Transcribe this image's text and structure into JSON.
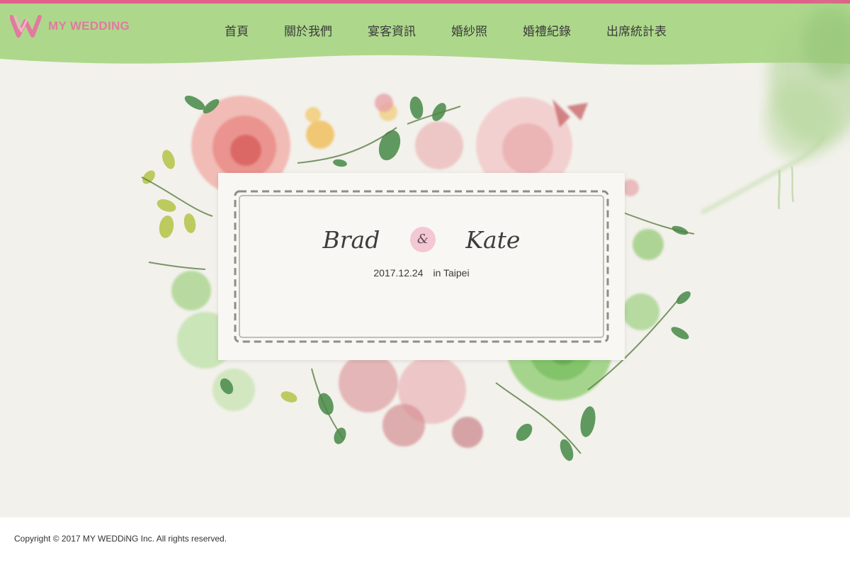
{
  "brand": {
    "name": "MY WEDDING",
    "color": "#e27aa0"
  },
  "accent": {
    "topline": "#e0608a",
    "nav_green": "#add88b"
  },
  "nav": {
    "items": [
      {
        "label": "首頁"
      },
      {
        "label": "關於我們"
      },
      {
        "label": "宴客資訊"
      },
      {
        "label": "婚紗照"
      },
      {
        "label": "婚禮紀錄"
      },
      {
        "label": "出席統計表"
      }
    ]
  },
  "hero": {
    "groom": "Brad",
    "ampersand": "&",
    "bride": "Kate",
    "date": "2017.12.24",
    "location": "in Taipei"
  },
  "footer": {
    "copyright": "Copyright © 2017 MY WEDDiNG Inc. All rights reserved."
  }
}
